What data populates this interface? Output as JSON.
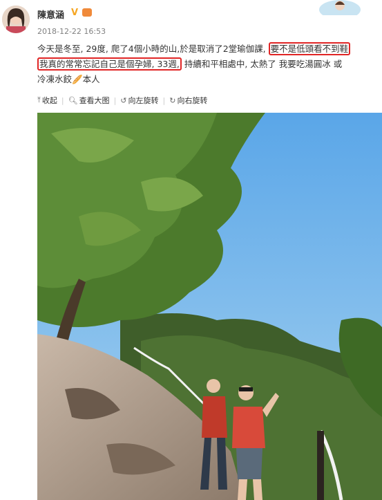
{
  "user": {
    "name": "陳意涵",
    "verified_badge": "V",
    "timestamp": "2018-12-22 16:53"
  },
  "post": {
    "text_part1": "今天是冬至, 29度, 爬了4個小時的山,於是取消了2堂瑜伽課,",
    "highlight1": "要不是低頭看不到鞋",
    "highlight2": "我真的常常忘記自己是個孕婦, 33週,",
    "text_part2": "持續和平相處中, 太熱了 我要吃湯圓冰 或",
    "text_part3": "冷凍水餃",
    "emoji": "🥖",
    "text_part4": "本人"
  },
  "toolbar": {
    "collapse_label": "收起",
    "view_large_label": "查看大图",
    "rotate_left_label": "向左旋转",
    "rotate_right_label": "向右旋转"
  },
  "icons": {
    "collapse": "collapse-icon",
    "view_large": "magnify-icon",
    "rotate_left": "rotate-left-icon",
    "rotate_right": "rotate-right-icon"
  },
  "colors": {
    "highlight_border": "#e02525",
    "timestamp": "#808080",
    "verified": "#f5a623"
  }
}
